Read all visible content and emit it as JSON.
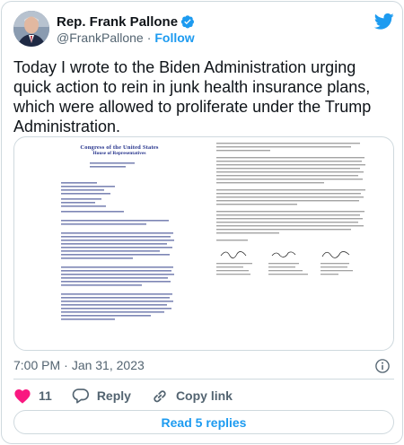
{
  "author": {
    "name": "Rep. Frank Pallone",
    "handle": "@FrankPallone",
    "separator": "·",
    "follow_label": "Follow",
    "verified": true
  },
  "tweet": {
    "text": "Today I wrote to the Biden Administration urging quick action to rein in junk health insurance plans, which were allowed to proliferate under the Trump Administration.",
    "time": "7:00 PM",
    "separator": "·",
    "date": "Jan 31, 2023"
  },
  "media": {
    "letterhead_line1": "Congress of the United States",
    "letterhead_line2": "House of Representatives"
  },
  "actions": {
    "like_count": "11",
    "reply_label": "Reply",
    "copy_link_label": "Copy link"
  },
  "footer": {
    "read_replies_label": "Read 5 replies"
  },
  "colors": {
    "accent": "#1d9bf0",
    "like": "#f91880",
    "text": "#0f1419",
    "muted": "#536471",
    "border": "#cfd9de"
  },
  "icons": [
    "verified-badge-icon",
    "twitter-bird-icon",
    "info-icon",
    "heart-icon",
    "reply-icon",
    "link-icon"
  ]
}
